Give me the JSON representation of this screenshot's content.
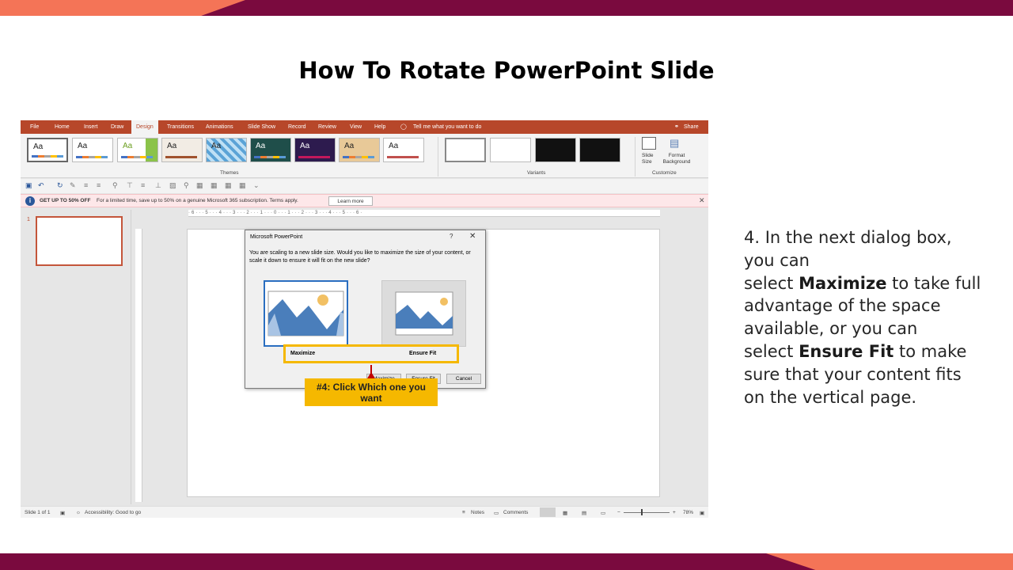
{
  "slide": {
    "title": "How To Rotate PowerPoint Slide",
    "description": {
      "line1": "4. In the next dialog box, you can",
      "pre_max": "select ",
      "maximize": "Maximize",
      "post_max": " to take full advantage of the space available, or you can",
      "pre_ensure": "select ",
      "ensure_fit": "Ensure Fit",
      "post_ensure": " to make sure that your content fits on the vertical page."
    },
    "colors": {
      "accent_dark": "#7a0a3e",
      "accent_light": "#f47457",
      "highlight": "#f5b800"
    }
  },
  "ppt": {
    "menu": [
      "File",
      "Home",
      "Insert",
      "Draw",
      "Design",
      "Transitions",
      "Animations",
      "Slide Show",
      "Record",
      "Review",
      "View",
      "Help"
    ],
    "tell_me": "Tell me what you want to do",
    "share": "Share",
    "ribbon": {
      "themes_label": "Themes",
      "variants_label": "Variants",
      "customize_label": "Customize",
      "slide_size": "Slide Size",
      "format_background": "Format Background",
      "theme_sample": "Aa"
    },
    "notice": {
      "heading": "GET UP TO 50% OFF",
      "text": "For a limited time, save up to 50% on a genuine Microsoft 365 subscription. Terms apply.",
      "button": "Learn more"
    },
    "ruler": "·6···5···4···3···2···1···0···1···2···3···4···5···6·",
    "slide_number": "1",
    "dialog": {
      "title": "Microsoft PowerPoint",
      "help": "?",
      "close": "✕",
      "message": "You are scaling to a new slide size.  Would you like to maximize the size of your content, or scale it down to ensure it will fit on the new slide?",
      "option_maximize": "Maximize",
      "option_ensure": "Ensure Fit",
      "btn_maximize": "Maximize",
      "btn_ensure": "Ensure Fit",
      "btn_cancel": "Cancel"
    },
    "callout": "#4: Click Which one you want",
    "status": {
      "slide_of": "Slide 1 of 1",
      "accessibility": "Accessibility: Good to go",
      "notes": "Notes",
      "comments": "Comments",
      "zoom": "78%"
    }
  }
}
